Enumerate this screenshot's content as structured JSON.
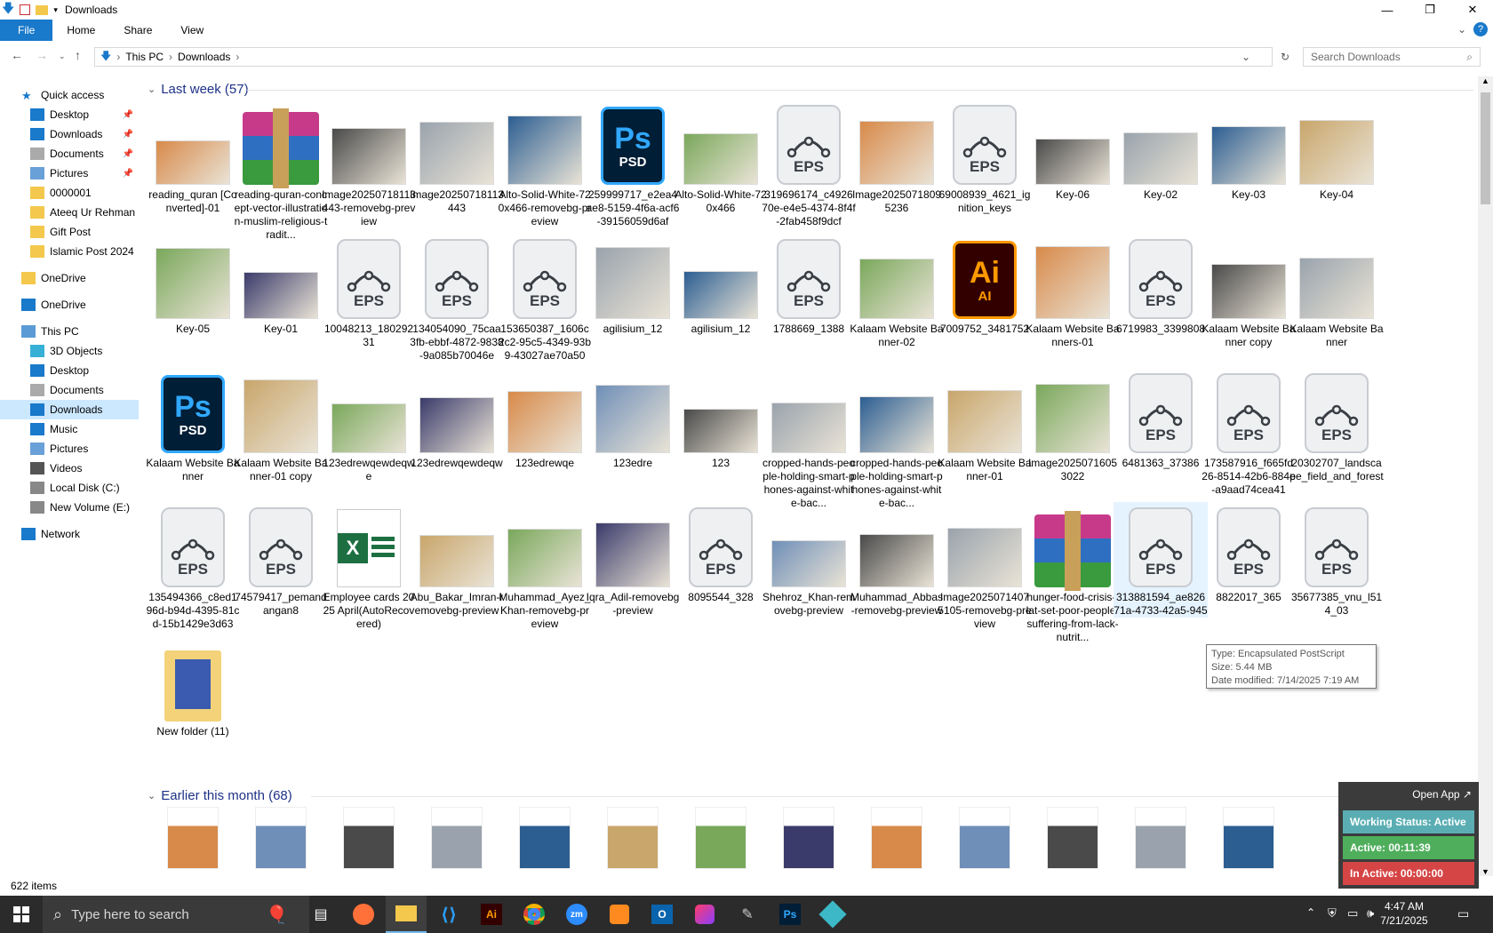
{
  "window": {
    "title": "Downloads",
    "minimize": "—",
    "maximize": "❐",
    "close": "✕"
  },
  "ribbon": {
    "file": "File",
    "home": "Home",
    "share": "Share",
    "view": "View"
  },
  "address": {
    "segments": [
      "This PC",
      "Downloads"
    ],
    "search_placeholder": "Search Downloads"
  },
  "sidebar": {
    "quick_access": "Quick access",
    "items": [
      {
        "label": "Desktop",
        "pinned": true
      },
      {
        "label": "Downloads",
        "pinned": true
      },
      {
        "label": "Documents",
        "pinned": true
      },
      {
        "label": "Pictures",
        "pinned": true
      },
      {
        "label": "0000001"
      },
      {
        "label": "Ateeq Ur Rehman"
      },
      {
        "label": "Gift Post"
      },
      {
        "label": "Islamic Post 2024"
      },
      {
        "label": "OneDrive"
      },
      {
        "label": "OneDrive"
      },
      {
        "label": "This PC"
      },
      {
        "label": "3D Objects"
      },
      {
        "label": "Desktop"
      },
      {
        "label": "Documents"
      },
      {
        "label": "Downloads"
      },
      {
        "label": "Music"
      },
      {
        "label": "Pictures"
      },
      {
        "label": "Videos"
      },
      {
        "label": "Local Disk (C:)"
      },
      {
        "label": "New Volume (E:)"
      },
      {
        "label": "Network"
      }
    ]
  },
  "groups": {
    "last_week": "Last week (57)",
    "earlier": "Earlier this month (68)"
  },
  "files": [
    {
      "name": "reading_quran [Converted]-01",
      "kind": "pic"
    },
    {
      "name": "reading-quran-concept-vector-illustration-muslim-religious-tradit...",
      "kind": "rar"
    },
    {
      "name": "Image20250718113443-removebg-preview",
      "kind": "pic"
    },
    {
      "name": "Image20250718113443",
      "kind": "pic"
    },
    {
      "name": "Alto-Solid-White-720x466-removebg-preview",
      "kind": "pic"
    },
    {
      "name": "259999717_e2ea4ae8-5159-4f6a-acf6-39156059d6af",
      "kind": "psd"
    },
    {
      "name": "Alto-Solid-White-720x466",
      "kind": "pic"
    },
    {
      "name": "319696174_c492670e-e4e5-4374-8f4f-2fab458f9dcf",
      "kind": "eps"
    },
    {
      "name": "Image20250718095236",
      "kind": "pic"
    },
    {
      "name": "69008939_4621_ignition_keys",
      "kind": "eps"
    },
    {
      "name": "Key-06",
      "kind": "pic"
    },
    {
      "name": "Key-02",
      "kind": "pic"
    },
    {
      "name": "Key-03",
      "kind": "pic"
    },
    {
      "name": "Key-04",
      "kind": "pic"
    },
    {
      "name": "Key-05",
      "kind": "pic"
    },
    {
      "name": "Key-01",
      "kind": "pic"
    },
    {
      "name": "10048213_18029231",
      "kind": "eps"
    },
    {
      "name": "134054090_75caa3fb-ebbf-4872-9838-9a085b70046e",
      "kind": "eps"
    },
    {
      "name": "153650387_1606c2c2-95c5-4349-93b9-43027ae70a50",
      "kind": "eps"
    },
    {
      "name": "agilisium_12",
      "kind": "pic"
    },
    {
      "name": "agilisium_12",
      "kind": "pic"
    },
    {
      "name": "1788669_1388",
      "kind": "eps"
    },
    {
      "name": "Kalaam Website Banner-02",
      "kind": "pic"
    },
    {
      "name": "7009752_3481752",
      "kind": "ai"
    },
    {
      "name": "Kalaam Website Banners-01",
      "kind": "pic"
    },
    {
      "name": "6719983_3399808",
      "kind": "eps"
    },
    {
      "name": "Kalaam Website Banner copy",
      "kind": "pic"
    },
    {
      "name": "Kalaam Website Banner",
      "kind": "pic"
    },
    {
      "name": "Kalaam Website Banner",
      "kind": "psd"
    },
    {
      "name": "Kalaam Website Banner-01 copy",
      "kind": "pic"
    },
    {
      "name": "123edrewqewdeqwe",
      "kind": "pic"
    },
    {
      "name": "123edrewqewdeqw",
      "kind": "pic"
    },
    {
      "name": "123edrewqe",
      "kind": "pic"
    },
    {
      "name": "123edre",
      "kind": "pic"
    },
    {
      "name": "123",
      "kind": "pic"
    },
    {
      "name": "cropped-hands-people-holding-smart-phones-against-white-bac...",
      "kind": "pic"
    },
    {
      "name": "cropped-hands-people-holding-smart-phones-against-white-bac...",
      "kind": "pic"
    },
    {
      "name": "Kalaam Website Banner-01",
      "kind": "pic"
    },
    {
      "name": "Image20250716053022",
      "kind": "pic"
    },
    {
      "name": "6481363_37386",
      "kind": "eps"
    },
    {
      "name": "173587916_f665fd26-8514-42b6-884e-a9aad74cea41",
      "kind": "eps"
    },
    {
      "name": "20302707_landscape_field_and_forest",
      "kind": "eps"
    },
    {
      "name": "135494366_c8ed196d-b94d-4395-81cd-15b1429e3d63",
      "kind": "eps"
    },
    {
      "name": "74579417_pemandangan8",
      "kind": "eps"
    },
    {
      "name": "Employee cards 2025 April(AutoRecovered)",
      "kind": "xlsx"
    },
    {
      "name": "Abu_Bakar_Imran-removebg-preview",
      "kind": "pic"
    },
    {
      "name": "Muhammad_Ayez_Khan-removebg-preview",
      "kind": "pic"
    },
    {
      "name": "Iqra_Adil-removebg-preview",
      "kind": "pic"
    },
    {
      "name": "8095544_328",
      "kind": "eps"
    },
    {
      "name": "Shehroz_Khan-removebg-preview",
      "kind": "pic"
    },
    {
      "name": "Muhammad_Abbas-removebg-preview",
      "kind": "pic"
    },
    {
      "name": "Image20250714075105-removebg-preview",
      "kind": "pic"
    },
    {
      "name": "hunger-food-crisis-flat-set-poor-people-suffering-from-lack-nutrit...",
      "kind": "rar"
    },
    {
      "name": "313881594_ae82671a-4733-42a5-945",
      "kind": "eps",
      "selected": true
    },
    {
      "name": "8822017_365",
      "kind": "eps"
    },
    {
      "name": "35677385_vnu_l514_03",
      "kind": "eps"
    },
    {
      "name": "New folder (11)",
      "kind": "folder"
    }
  ],
  "eps_label": "EPS",
  "psd_big": "Ps",
  "psd_small": "PSD",
  "ai_big": "Ai",
  "ai_small": "AI",
  "tooltip": {
    "type": "Type: Encapsulated PostScript",
    "size": "Size: 5.44 MB",
    "modified": "Date modified: 7/14/2025 7:19 AM"
  },
  "status": {
    "items": "622 items"
  },
  "widget": {
    "open_app": "Open App ↗",
    "working": "Working Status: Active",
    "active": "Active: 00:11:39",
    "inactive": "In Active: 00:00:00"
  },
  "taskbar": {
    "search_placeholder": "Type here to search",
    "time": "4:47 AM",
    "date": "7/21/2025"
  },
  "colors": {
    "accent": "#1979ca",
    "selection": "#cce8ff",
    "group_header": "#1e3287",
    "widget_green": "#4fae5c",
    "widget_teal": "#5aaeb3",
    "widget_red": "#d64545"
  }
}
